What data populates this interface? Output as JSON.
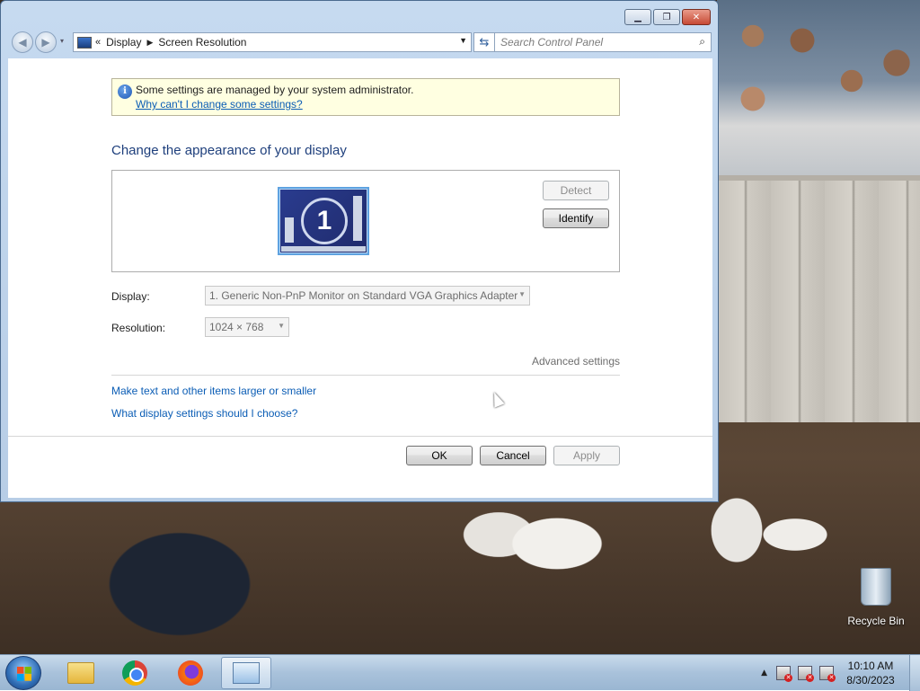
{
  "window": {
    "breadcrumb": {
      "parent": "Display",
      "current": "Screen Resolution"
    },
    "search_placeholder": "Search Control Panel"
  },
  "notice": {
    "text": "Some settings are managed by your system administrator.",
    "link": "Why can't I change some settings?"
  },
  "main": {
    "heading": "Change the appearance of your display",
    "monitor_number": "1",
    "detect_label": "Detect",
    "identify_label": "Identify",
    "display_label": "Display:",
    "display_value": "1. Generic Non-PnP Monitor on Standard VGA Graphics Adapter",
    "resolution_label": "Resolution:",
    "resolution_value": "1024 × 768",
    "advanced_label": "Advanced settings",
    "link_text_size": "Make text and other items larger or smaller",
    "link_display_settings": "What display settings should I choose?"
  },
  "footer": {
    "ok_label": "OK",
    "cancel_label": "Cancel",
    "apply_label": "Apply"
  },
  "desktop": {
    "recycle_bin_label": "Recycle Bin"
  },
  "taskbar": {
    "apps": [
      "file-explorer-icon",
      "chrome-icon",
      "firefox-icon",
      "display-settings-icon"
    ],
    "clock_time": "10:10 AM",
    "clock_date": "8/30/2023"
  }
}
